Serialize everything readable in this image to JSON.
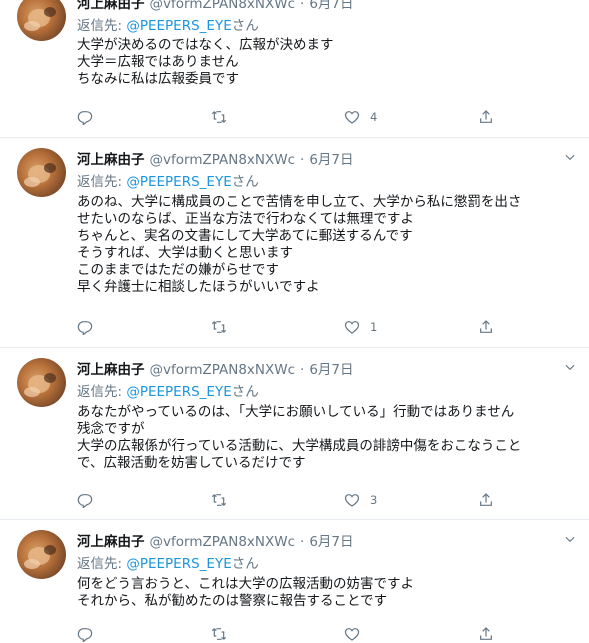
{
  "tweets": [
    {
      "display_name": "河上麻由子",
      "handle": "@vformZPAN8xNXWc",
      "date": "6月7日",
      "reply_prefix": "返信先: ",
      "reply_mention": "@PEEPERS_EYE",
      "reply_suffix": "さん",
      "lines": [
        "大学が決めるのではなく、広報が決めます",
        "大学＝広報ではありません",
        "ちなみに私は広報委員です"
      ],
      "reply_count": "",
      "retweet_count": "",
      "like_count": "4"
    },
    {
      "display_name": "河上麻由子",
      "handle": "@vformZPAN8xNXWc",
      "date": "6月7日",
      "reply_prefix": "返信先: ",
      "reply_mention": "@PEEPERS_EYE",
      "reply_suffix": "さん",
      "lines": [
        "あのね、大学に構成員のことで苦情を申し立て、大学から私に懲罰を出さ",
        "せたいのならば、正当な方法で行わなくては無理ですよ",
        "ちゃんと、実名の文書にして大学あてに郵送するんです",
        "そうすれば、大学は動くと思います",
        "このままではただの嫌がらせです",
        "早く弁護士に相談したほうがいいですよ"
      ],
      "reply_count": "",
      "retweet_count": "",
      "like_count": "1"
    },
    {
      "display_name": "河上麻由子",
      "handle": "@vformZPAN8xNXWc",
      "date": "6月7日",
      "reply_prefix": "返信先: ",
      "reply_mention": "@PEEPERS_EYE",
      "reply_suffix": "さん",
      "lines": [
        "あなたがやっているのは、「大学にお願いしている」行動ではありません",
        "残念ですが",
        "大学の広報係が行っている活動に、大学構成員の誹謗中傷をおこなうこと",
        "で、広報活動を妨害しているだけです"
      ],
      "reply_count": "",
      "retweet_count": "",
      "like_count": "3"
    },
    {
      "display_name": "河上麻由子",
      "handle": "@vformZPAN8xNXWc",
      "date": "6月7日",
      "reply_prefix": "返信先: ",
      "reply_mention": "@PEEPERS_EYE",
      "reply_suffix": "さん",
      "lines": [
        "何をどう言おうと、これは大学の広報活動の妨害ですよ",
        "それから、私が勧めたのは警察に報告することです"
      ],
      "reply_count": "",
      "retweet_count": "",
      "like_count": ""
    }
  ],
  "separator": "·",
  "icons": [
    "reply-icon",
    "retweet-icon",
    "like-icon",
    "share-icon",
    "chevron-down-icon"
  ],
  "colors": {
    "link": "#1b95e0",
    "muted": "#657786",
    "text": "#14171a",
    "border": "#e6ecf0"
  }
}
